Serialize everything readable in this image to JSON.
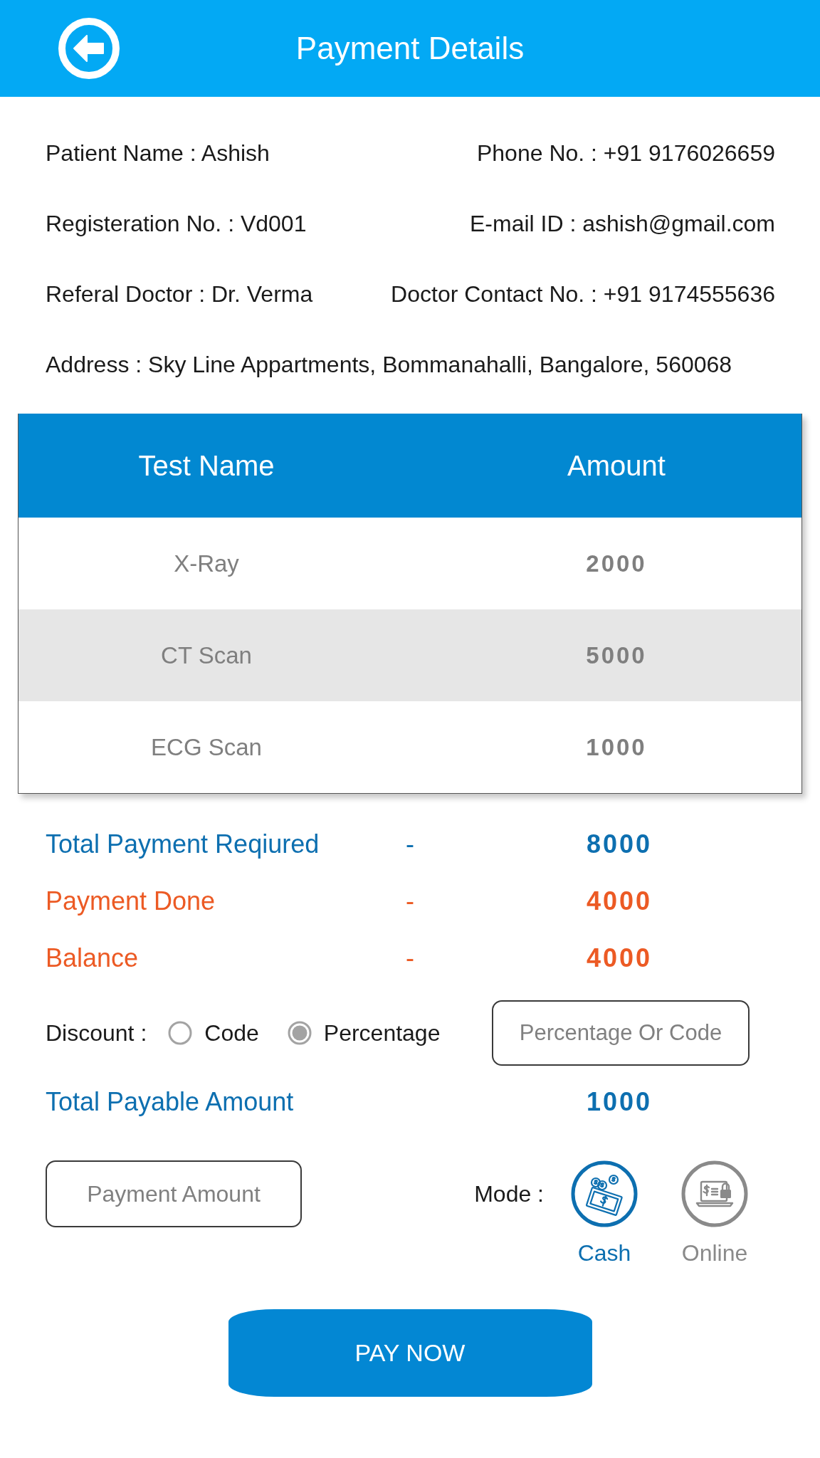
{
  "header": {
    "title": "Payment Details"
  },
  "details": [
    {
      "items": [
        "Patient Name : Ashish",
        "Phone No. : +91 9176026659"
      ]
    },
    {
      "items": [
        "Registeration No. : Vd001",
        "E-mail ID : ashish@gmail.com"
      ]
    },
    {
      "items": [
        "Referal Doctor : Dr. Verma",
        "Doctor Contact No. : +91 9174555636"
      ]
    },
    {
      "items": [
        "Address : Sky Line Appartments, Bommanahalli, Bangalore, 560068"
      ]
    }
  ],
  "tests": {
    "columns": [
      "Test Name",
      "Amount"
    ],
    "rows": [
      {
        "test_name": "X-Ray",
        "amount": "2000"
      },
      {
        "test_name": "CT Scan",
        "amount": "5000"
      },
      {
        "test_name": "ECG Scan",
        "amount": "1000"
      }
    ]
  },
  "summary": [
    {
      "label": "Total Payment Reqiured",
      "separator": "-",
      "value": "8000",
      "color": "#0d6fb0"
    },
    {
      "label": "Payment Done",
      "separator": "-",
      "value": "4000",
      "color": "#ec5a24"
    },
    {
      "label": "Balance",
      "separator": "-",
      "value": "4000",
      "color": "#ec5a24"
    }
  ],
  "discount": {
    "label": "Discount :",
    "options": [
      {
        "label": "Code",
        "selected": false
      },
      {
        "label": "Percentage",
        "selected": true
      }
    ],
    "input": {
      "placeholder": "Percentage Or Code"
    }
  },
  "total_payable": {
    "label": "Total Payable Amount",
    "value": "1000"
  },
  "payment_amount": {
    "placeholder": "Payment Amount"
  },
  "mode": {
    "label": "Mode :",
    "options": [
      {
        "label": "Cash",
        "kind": "cash",
        "selected": true
      },
      {
        "label": "Online",
        "kind": "online",
        "selected": false
      }
    ]
  },
  "pay_button": {
    "label": "PAY NOW"
  }
}
